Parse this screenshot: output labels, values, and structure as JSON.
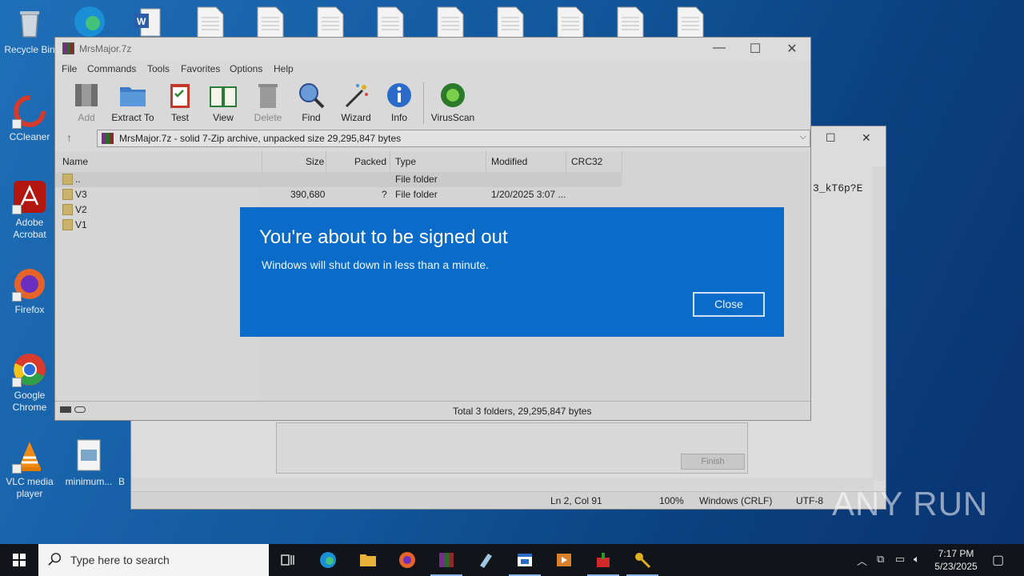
{
  "desktop": {
    "icons": [
      {
        "label": "Recycle Bin"
      },
      {
        "label": "CCleaner"
      },
      {
        "label": "Adobe Acrobat"
      },
      {
        "label": "Firefox"
      },
      {
        "label": "Google Chrome"
      },
      {
        "label": "VLC media player"
      },
      {
        "label": "minimum..."
      },
      {
        "label": "B"
      }
    ]
  },
  "notepad": {
    "text_fragment": "3_kT6p?E",
    "status": {
      "position": "Ln 2, Col 91",
      "zoom": "100%",
      "line_ending": "Windows (CRLF)",
      "encoding": "UTF-8"
    },
    "finish_label": "Finish"
  },
  "winrar": {
    "title": "MrsMajor.7z",
    "menu": [
      "File",
      "Commands",
      "Tools",
      "Favorites",
      "Options",
      "Help"
    ],
    "toolbar": [
      "Add",
      "Extract To",
      "Test",
      "View",
      "Delete",
      "Find",
      "Wizard",
      "Info",
      "VirusScan"
    ],
    "address": "MrsMajor.7z - solid 7-Zip archive, unpacked size 29,295,847 bytes",
    "columns": [
      "Name",
      "Size",
      "Packed",
      "Type",
      "Modified",
      "CRC32"
    ],
    "rows": [
      {
        "name": "..",
        "size": "",
        "packed": "",
        "type": "File folder",
        "modified": ""
      },
      {
        "name": "V3",
        "size": "390,680",
        "packed": "?",
        "type": "File folder",
        "modified": "1/20/2025 3:07 ..."
      },
      {
        "name": "V2",
        "size": "",
        "packed": "",
        "type": "",
        "modified": ""
      },
      {
        "name": "V1",
        "size": "",
        "packed": "",
        "type": "",
        "modified": ""
      }
    ],
    "status": "Total 3 folders, 29,295,847 bytes"
  },
  "dialog": {
    "title": "You're about to be signed out",
    "message": "Windows will shut down in less than a minute.",
    "close_label": "Close"
  },
  "taskbar": {
    "search_placeholder": "Type here to search",
    "time": "7:17 PM",
    "date": "5/23/2025"
  },
  "watermark": "ANY RUN"
}
